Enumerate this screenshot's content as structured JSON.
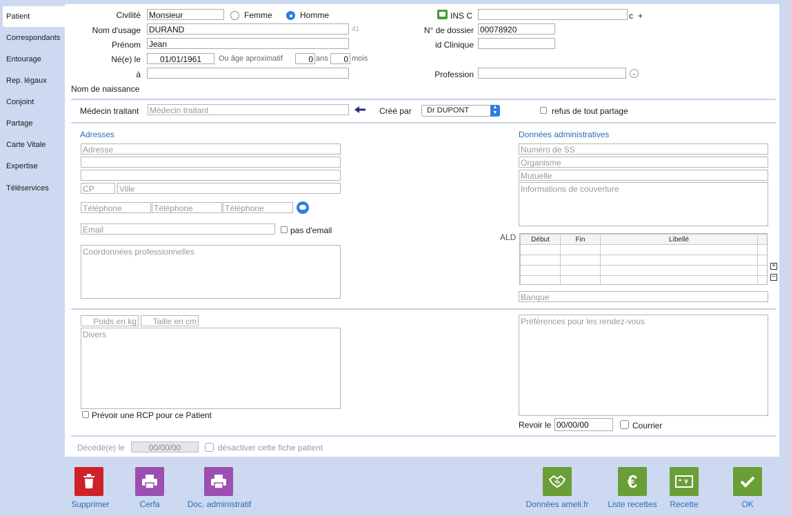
{
  "sidebar": {
    "items": [
      {
        "label": "Patient"
      },
      {
        "label": "Correspondants"
      },
      {
        "label": "Entourage"
      },
      {
        "label": "Rep. légaux"
      },
      {
        "label": "Conjoint"
      },
      {
        "label": "Partage"
      },
      {
        "label": "Carte Vitale"
      },
      {
        "label": "Expertise"
      },
      {
        "label": "Téléservices"
      }
    ]
  },
  "identity": {
    "civilite_label": "Civilité",
    "civilite_value": "Monsieur",
    "femme_label": "Femme",
    "homme_label": "Homme",
    "nom_usage_label": "Nom d'usage",
    "nom_usage_value": "DURAND",
    "nom_usage_count": "41",
    "prenom_label": "Prénom",
    "prenom_value": "Jean",
    "ne_le_label": "Né(e) le",
    "ne_le_value": "01/01/1961",
    "age_label": "Ou âge aproximatif",
    "age_years": "0",
    "ans_label": "ans",
    "age_months": "0",
    "mois_label": "mois",
    "a_label": "à",
    "nom_naissance_label": "Nom de naissance"
  },
  "admin_ids": {
    "ins_label": "INS C",
    "ins_suffix_c": "c",
    "ins_suffix_plus": "+",
    "dossier_label": "N° de dossier",
    "dossier_value": "00078920",
    "clinique_label": "id Clinique",
    "profession_label": "Profession"
  },
  "medecin": {
    "label": "Médecin traitant",
    "placeholder": "Médecin traitant",
    "cree_par_label": "Créé par",
    "cree_par_value": "Dr DUPONT",
    "refus_label": "refus de tout partage"
  },
  "adresses": {
    "title": "Adresses",
    "adresse_ph": "Adresse",
    "cp_ph": "CP",
    "ville_ph": "Ville",
    "tel_ph": "Téléphone",
    "email_ph": "Email",
    "pas_email_label": "pas d'email",
    "coord_pro_ph": "Coordonnées professionnelles"
  },
  "donnees_admin": {
    "title": "Données administratives",
    "ss_ph": "Numéro de SS",
    "organisme_ph": "Organisme",
    "mutuelle_ph": "Mutuelle",
    "couverture_ph": "Informations de couverture",
    "ald_label": "ALD",
    "ald_columns": [
      "Début",
      "Fin",
      "Libellé"
    ],
    "banque_ph": "Banque"
  },
  "divers": {
    "poids_ph": "Poids en kg",
    "taille_ph": "Taille en cm",
    "divers_ph": "Divers",
    "rcp_label": "Prévoir une RCP pour ce Patient",
    "rdv_ph": "Préférences pour les rendez-vous",
    "revoir_label": "Revoir le",
    "revoir_value": "00/00/00",
    "courrier_label": "Courrier"
  },
  "footer": {
    "decede_label": "Décédé(e) le",
    "decede_value": "00/00/00",
    "desactiver_label": "désactiver cette fiche patient"
  },
  "actions": {
    "supprimer": "Supprimer",
    "cerfa": "Cerfa",
    "doc_admin": "Doc. administratif",
    "ameli": "Données ameli.fr",
    "liste_recettes": "Liste recettes",
    "recette": "Recette",
    "ok": "OK"
  },
  "colors": {
    "red": "#d0202a",
    "purple": "#9b4fb0",
    "green": "#6a9e36",
    "accent_blue": "#2a6db5"
  }
}
